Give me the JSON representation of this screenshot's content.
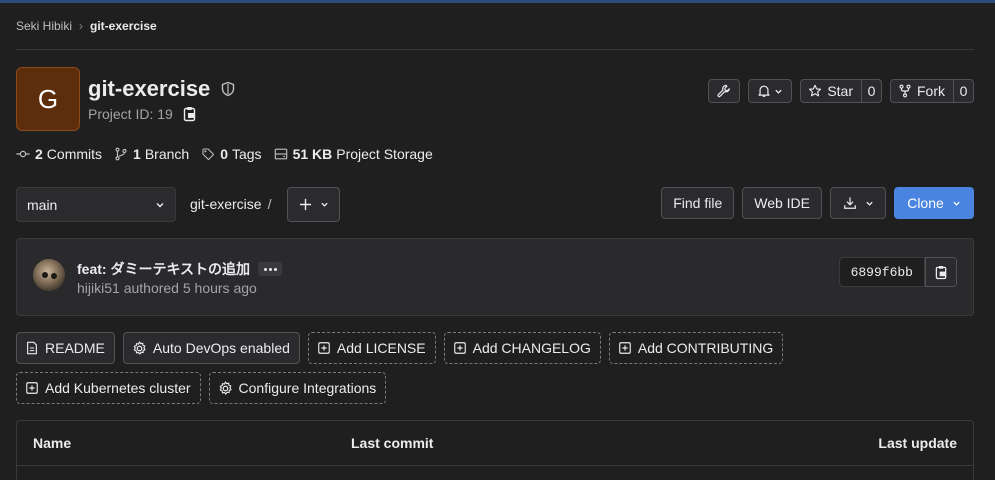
{
  "breadcrumb": {
    "user": "Seki Hibiki",
    "separator": "›",
    "project": "git-exercise"
  },
  "project": {
    "avatar_letter": "G",
    "name": "git-exercise",
    "id_label": "Project ID: 19"
  },
  "actions": {
    "star_label": "Star",
    "star_count": "0",
    "fork_label": "Fork",
    "fork_count": "0"
  },
  "stats": {
    "commits_count": "2",
    "commits_label": "Commits",
    "branch_count": "1",
    "branch_label": "Branch",
    "tags_count": "0",
    "tags_label": "Tags",
    "storage_size": "51 KB",
    "storage_label": "Project Storage"
  },
  "toolbar": {
    "branch": "main",
    "path": "git-exercise",
    "path_sep": "/",
    "find_file": "Find file",
    "web_ide": "Web IDE",
    "clone": "Clone"
  },
  "commit": {
    "title": "feat: ダミーテキストの追加",
    "author": "hijiki51",
    "meta_suffix": "authored 5 hours ago",
    "sha": "6899f6bb"
  },
  "pills": [
    {
      "label": "README",
      "icon": "document-icon",
      "style": "solid"
    },
    {
      "label": "Auto DevOps enabled",
      "icon": "settings-icon",
      "style": "solid"
    },
    {
      "label": "Add LICENSE",
      "icon": "plus-square-icon",
      "style": "dashed"
    },
    {
      "label": "Add CHANGELOG",
      "icon": "plus-square-icon",
      "style": "dashed"
    },
    {
      "label": "Add CONTRIBUTING",
      "icon": "plus-square-icon",
      "style": "dashed"
    },
    {
      "label": "Add Kubernetes cluster",
      "icon": "plus-square-icon",
      "style": "dashed"
    },
    {
      "label": "Configure Integrations",
      "icon": "settings-icon",
      "style": "dashed"
    }
  ],
  "table": {
    "col_name": "Name",
    "col_commit": "Last commit",
    "col_update": "Last update"
  },
  "colors": {
    "background": "#1f1f1f",
    "accent": "#4a84e0",
    "avatar": "#5e2d0c"
  }
}
